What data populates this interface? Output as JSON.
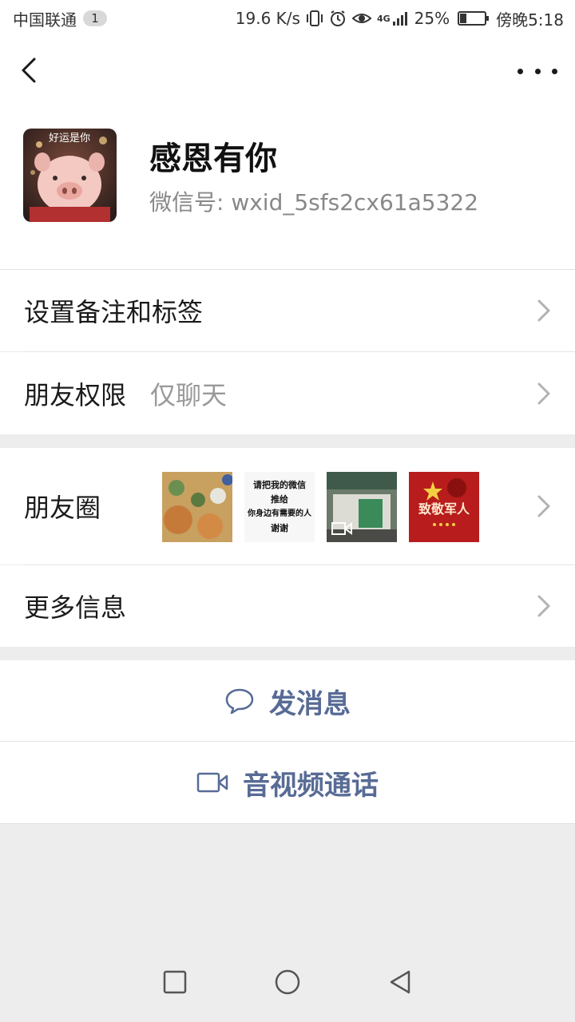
{
  "status_bar": {
    "carrier": "中国联通",
    "notification_count": "1",
    "net_speed": "19.6 K/s",
    "network_type": "4G",
    "battery_percent": "25%",
    "battery_level": 0.25,
    "time": "傍晚5:18"
  },
  "profile": {
    "name": "感恩有你",
    "wechat_id": "微信号: wxid_5sfs2cx61a5322",
    "avatar_caption": "好运是你"
  },
  "menu": {
    "remark_tags": "设置备注和标签",
    "friend_permission_label": "朋友权限",
    "friend_permission_value": "仅聊天",
    "moments_label": "朋友圈",
    "more_info": "更多信息"
  },
  "moments_thumbs": {
    "thumb2_lines": [
      "请把我的微信",
      "推给",
      "你身边有需要的人",
      "谢谢"
    ],
    "thumb4_text": "致敬军人"
  },
  "actions": {
    "send_message": "发消息",
    "av_call": "音视频通话"
  },
  "colors": {
    "accent": "#576b95",
    "background": "#ededed",
    "chevron": "#b2b2b2"
  }
}
